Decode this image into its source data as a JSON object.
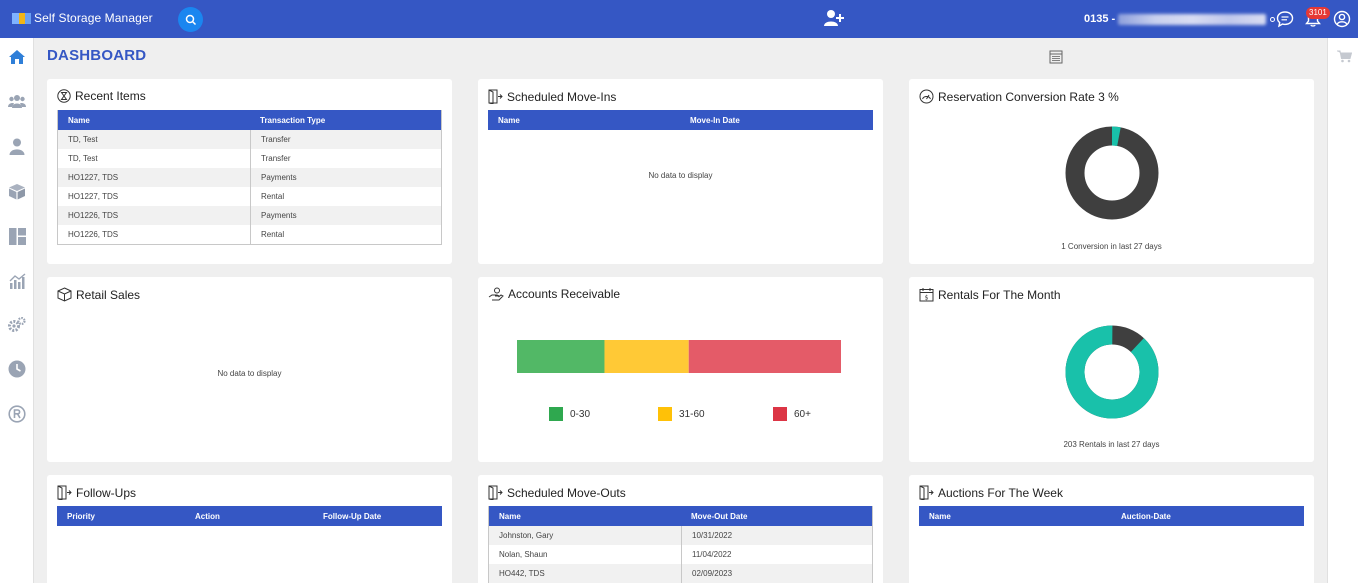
{
  "app": {
    "title": "Self Storage Manager",
    "account_prefix": "0135 -",
    "notification_count": "3101"
  },
  "colors": {
    "brand": "#3557c4",
    "green": "#52b866",
    "yellow": "#ffc936",
    "red": "#e45b68",
    "teal": "#19c1aa",
    "dark": "#3f3f3f"
  },
  "page": {
    "title": "DASHBOARD"
  },
  "nav": [
    "home-icon",
    "people-icon",
    "user-icon",
    "box-icon",
    "dashboard-icon",
    "chart-icon",
    "settings-icon",
    "clock-icon",
    "registered-icon"
  ],
  "cards": {
    "recent_items": {
      "title": "Recent Items",
      "columns": [
        "Name",
        "Transaction Type"
      ],
      "rows": [
        [
          "TD, Test",
          "Transfer"
        ],
        [
          "TD, Test",
          "Transfer"
        ],
        [
          "HO1227, TDS",
          "Payments"
        ],
        [
          "HO1227, TDS",
          "Rental"
        ],
        [
          "HO1226, TDS",
          "Payments"
        ],
        [
          "HO1226, TDS",
          "Rental"
        ]
      ]
    },
    "move_ins": {
      "title": "Scheduled Move-Ins",
      "columns": [
        "Name",
        "Move-In Date"
      ],
      "empty": "No data to display"
    },
    "conversion": {
      "title": "Reservation Conversion Rate 3 %",
      "caption": "1 Conversion in last 27 days",
      "percent": 3
    },
    "retail": {
      "title": "Retail Sales",
      "empty": "No data to display"
    },
    "receivable": {
      "title": "Accounts Receivable",
      "segments": [
        {
          "label": "0-30",
          "share": 0.27,
          "color": "#52b866",
          "legend_color": "#2fa84f"
        },
        {
          "label": "31-60",
          "share": 0.26,
          "color": "#ffc936",
          "legend_color": "#ffc107"
        },
        {
          "label": "60+",
          "share": 0.47,
          "color": "#e45b68",
          "legend_color": "#dc3545"
        }
      ]
    },
    "rentals": {
      "title": "Rentals For The Month",
      "caption": "203 Rentals in last 27 days",
      "percent": 88
    },
    "followups": {
      "title": "Follow-Ups",
      "columns": [
        "Priority",
        "Action",
        "Follow-Up Date"
      ]
    },
    "move_outs": {
      "title": "Scheduled Move-Outs",
      "columns": [
        "Name",
        "Move-Out Date"
      ],
      "rows": [
        [
          "Johnston, Gary",
          "10/31/2022"
        ],
        [
          "Nolan, Shaun",
          "11/04/2022"
        ],
        [
          "HO442, TDS",
          "02/09/2023"
        ]
      ]
    },
    "auctions": {
      "title": "Auctions For The Week",
      "columns": [
        "Name",
        "Auction-Date"
      ]
    }
  }
}
